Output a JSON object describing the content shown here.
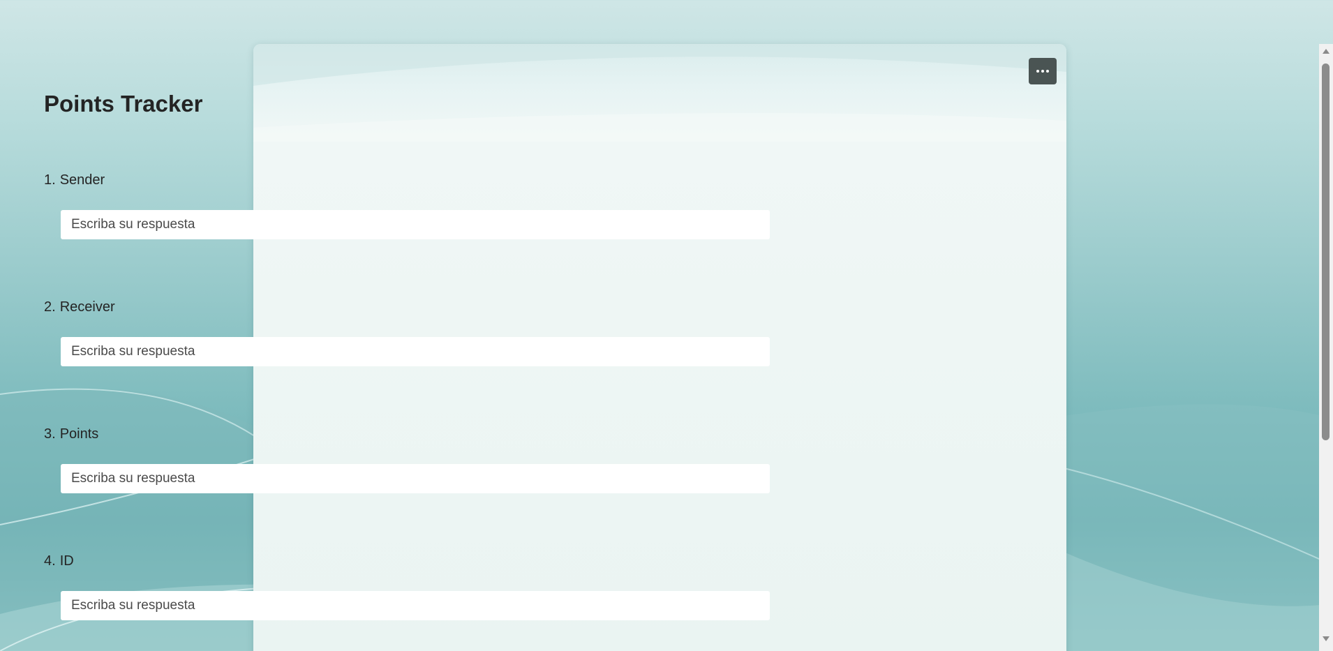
{
  "form": {
    "title": "Points Tracker",
    "more_icon": "more-horizontal-icon",
    "questions": [
      {
        "number": "1.",
        "label": "Sender",
        "placeholder": "Escriba su respuesta",
        "value": ""
      },
      {
        "number": "2.",
        "label": "Receiver",
        "placeholder": "Escriba su respuesta",
        "value": ""
      },
      {
        "number": "3.",
        "label": "Points",
        "placeholder": "Escriba su respuesta",
        "value": ""
      },
      {
        "number": "4.",
        "label": "ID",
        "placeholder": "Escriba su respuesta",
        "value": ""
      }
    ]
  },
  "theme": {
    "background_top": "#cfe6e6",
    "background_mid": "#7fbcbe",
    "card_background": "#eef6f4",
    "more_button_color": "#4a5453",
    "title_color": "#242424"
  }
}
